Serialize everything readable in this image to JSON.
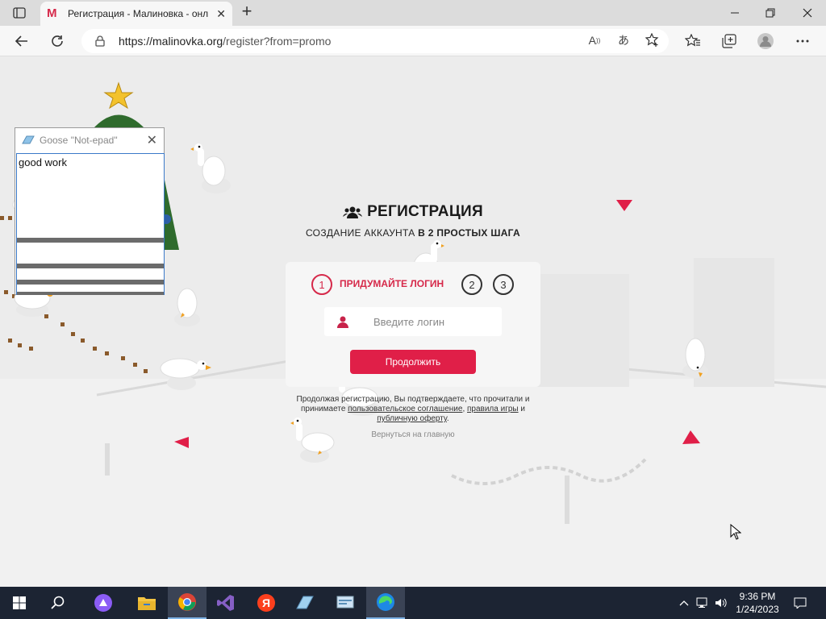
{
  "browser": {
    "tab_title": "Регистрация - Малиновка - онл",
    "favicon_letter": "M",
    "url_host": "https://malinovka.org",
    "url_path": "/register?from=promo"
  },
  "registration": {
    "title": "РЕГИСТРАЦИЯ",
    "subtitle_prefix": "СОЗДАНИЕ АККАУНТА ",
    "subtitle_bold": "В 2 ПРОСТЫХ ШАГА",
    "steps": [
      "1",
      "2",
      "3"
    ],
    "step_label": "ПРИДУМАЙТЕ ЛОГИН",
    "login_placeholder": "Введите логин",
    "continue_label": "Продолжить",
    "terms_text_1": "Продолжая регистрацию, Вы подтверждаете, что прочитали и принимаете ",
    "terms_link_agreement": "пользовательское соглашение",
    "terms_text_2": ",",
    "terms_link_rules": "правила игры",
    "terms_text_3": " и ",
    "terms_link_offer": "публичную оферту",
    "terms_text_4": ".",
    "back_link": "Вернуться на главную",
    "accent_color": "#e01f48"
  },
  "notepad": {
    "title": "Goose \"Not-epad\"",
    "content": "good work"
  },
  "taskbar": {
    "apps": [
      "start-icon",
      "search-icon",
      "alice-icon",
      "file-explorer-icon",
      "chrome-icon",
      "visual-studio-icon",
      "yandex-browser-icon",
      "notepad-icon",
      "control-panel-icon",
      "edge-icon"
    ],
    "time": "9:36 PM",
    "date": "1/24/2023"
  }
}
